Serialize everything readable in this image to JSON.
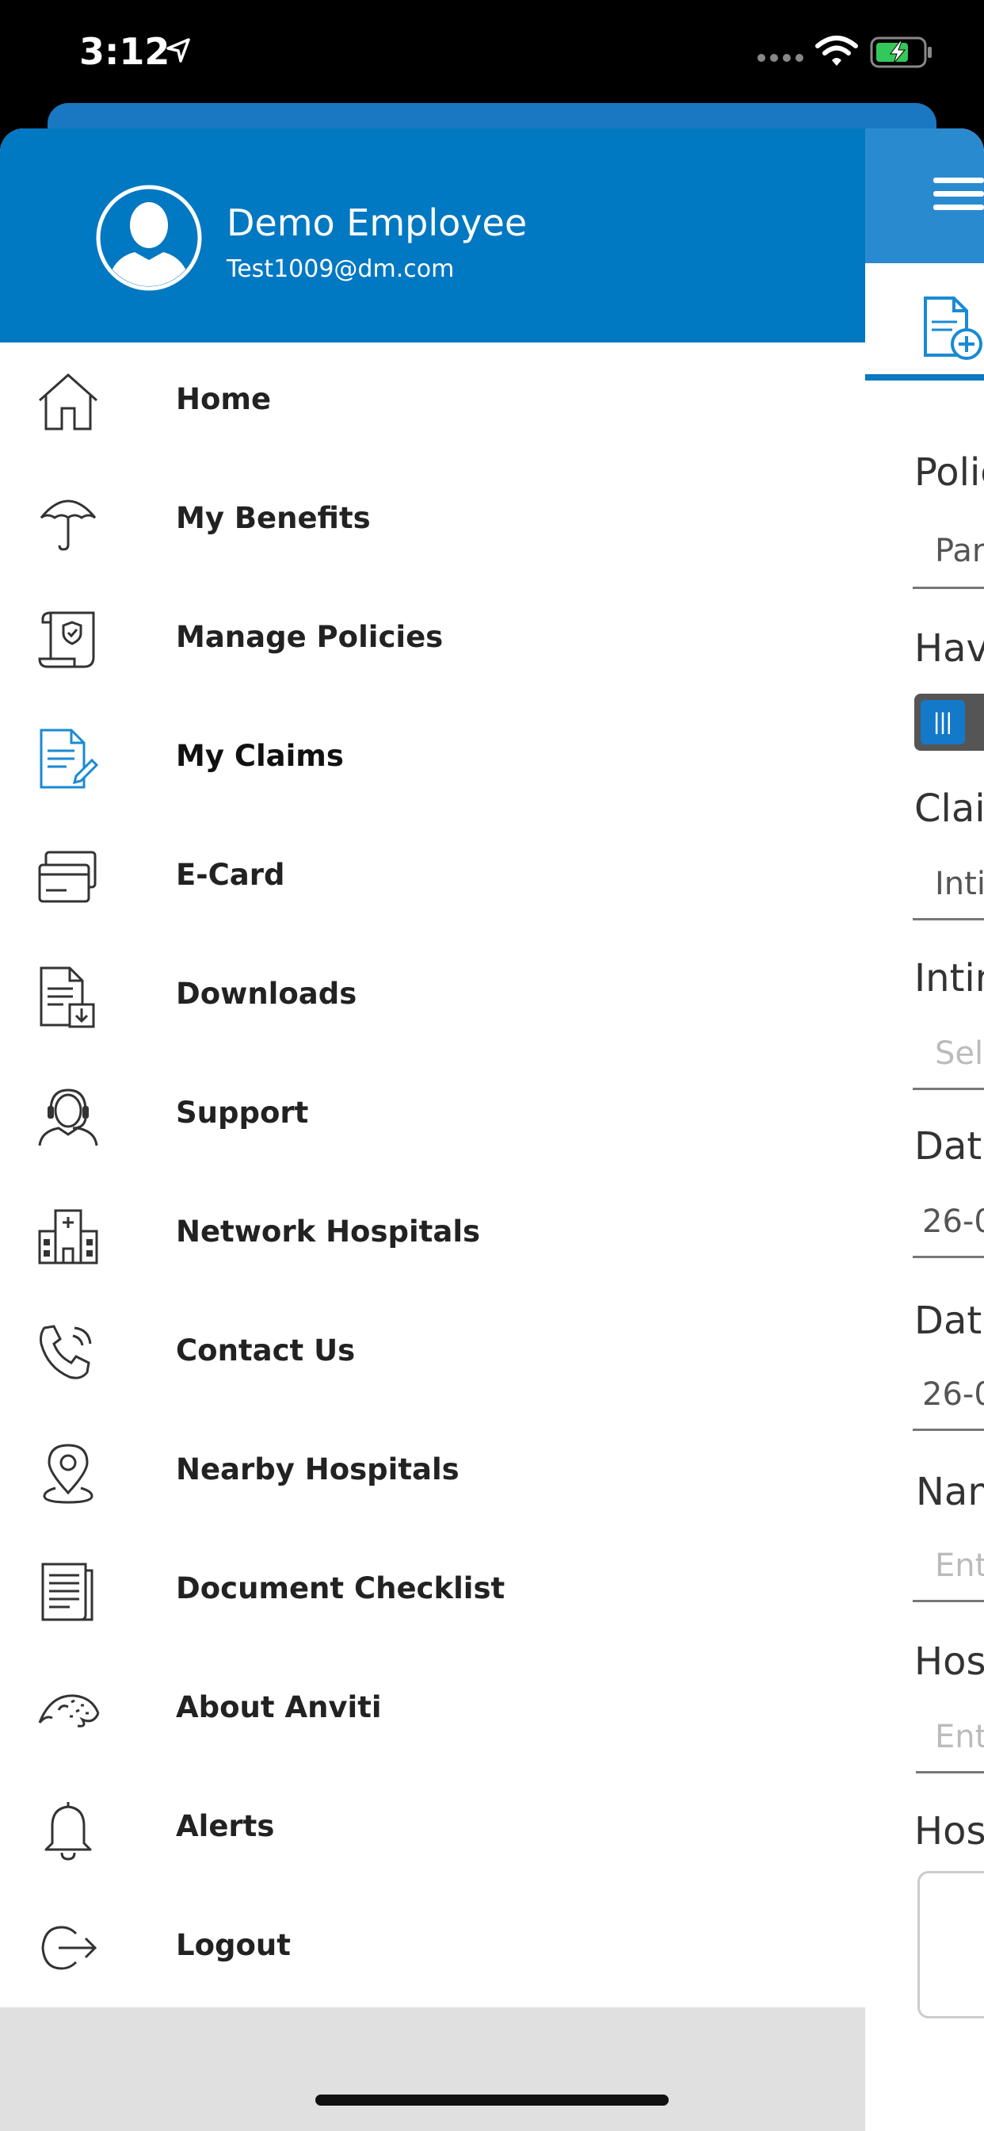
{
  "status_bar": {
    "time": "3:12"
  },
  "user": {
    "name": "Demo Employee",
    "email": "Test1009@dm.com"
  },
  "menu": [
    {
      "label": "Home",
      "icon": "home-icon"
    },
    {
      "label": "My Benefits",
      "icon": "umbrella-icon"
    },
    {
      "label": "Manage Policies",
      "icon": "policy-scroll-icon"
    },
    {
      "label": "My Claims",
      "icon": "claims-edit-icon",
      "active": true
    },
    {
      "label": "E-Card",
      "icon": "card-icon"
    },
    {
      "label": "Downloads",
      "icon": "download-document-icon"
    },
    {
      "label": "Support",
      "icon": "headset-agent-icon"
    },
    {
      "label": "Network Hospitals",
      "icon": "hospital-icon"
    },
    {
      "label": "Contact Us",
      "icon": "phone-icon"
    },
    {
      "label": "Nearby Hospitals",
      "icon": "location-pin-icon"
    },
    {
      "label": "Document Checklist",
      "icon": "checklist-document-icon"
    },
    {
      "label": "About Anviti",
      "icon": "anviti-logo-icon"
    },
    {
      "label": "Alerts",
      "icon": "bell-icon"
    },
    {
      "label": "Logout",
      "icon": "logout-icon"
    }
  ],
  "background_form": {
    "labels": [
      "Polic",
      "Have",
      "Clain",
      "Intin",
      "Date",
      "Date",
      "Nam",
      "Hos",
      "Hos"
    ],
    "values": [
      "Par",
      "Inti",
      "Sel",
      "26-0",
      "26-0",
      "Ent",
      "Ent"
    ]
  },
  "colors": {
    "primary": "#0178c2",
    "accent_icon": "#1a8ad4"
  }
}
